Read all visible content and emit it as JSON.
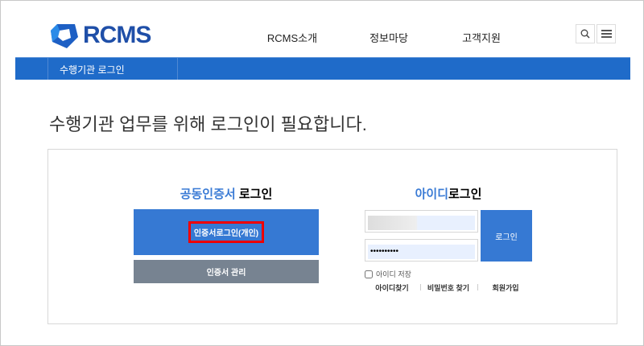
{
  "header": {
    "logo": "RCMS",
    "nav": [
      "RCMS소개",
      "정보마당",
      "고객지원"
    ],
    "search_icon": "search-icon",
    "menu_icon": "menu-icon"
  },
  "subbar": {
    "title": "수행기관 로그인"
  },
  "page_title": "수행기관 업무를 위해 로그인이 필요합니다.",
  "cert": {
    "title_accent": "공동인증서",
    "title_rest": " 로그인",
    "login_button": "인증서로그인(개인)",
    "manage_button": "인증서 관리"
  },
  "id_login": {
    "title_accent": "아이디",
    "title_rest": "로그인",
    "id_value": "",
    "password_value": "••••••••••",
    "login_button": "로그인",
    "remember_label": "아이디 저장",
    "links": [
      "아이디찾기",
      "비밀번호 찾기",
      "회원가입"
    ]
  },
  "colors": {
    "brand": "#1f6bc9",
    "button": "#3679d3",
    "highlight": "#ee0000"
  }
}
